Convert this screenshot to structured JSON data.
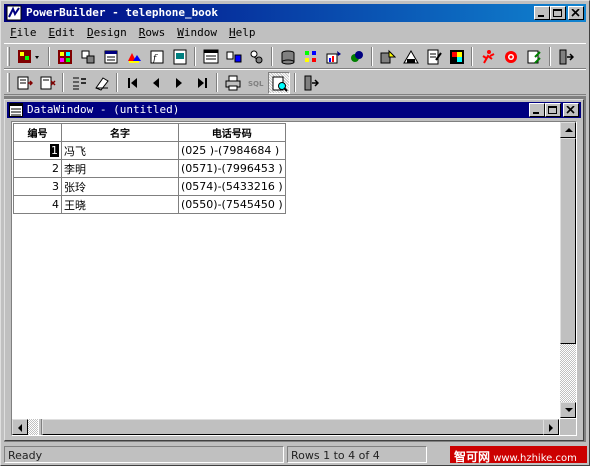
{
  "window": {
    "title": "PowerBuilder - telephone_book",
    "controls": [
      "minimize",
      "maximize",
      "close"
    ]
  },
  "menubar": [
    {
      "label": "File",
      "hotkey": "F",
      "rest": "ile"
    },
    {
      "label": "Edit",
      "hotkey": "E",
      "rest": "dit"
    },
    {
      "label": "Design",
      "hotkey": "D",
      "rest": "esign"
    },
    {
      "label": "Rows",
      "hotkey": "R",
      "rest": "ows"
    },
    {
      "label": "Window",
      "hotkey": "W",
      "rest": "indow"
    },
    {
      "label": "Help",
      "hotkey": "H",
      "rest": "elp"
    }
  ],
  "toolbar1": [
    "application-icon",
    "window-painter-icon",
    "user-object-icon",
    "menu-painter-icon",
    "structure-icon",
    "function-icon",
    "project-icon",
    "datawindow-icon",
    "query-icon",
    "pipeline-icon",
    "database-icon",
    "db-profile-icon",
    "library-icon",
    "browser-icon",
    "library-painter-icon",
    "edit-icon",
    "report-icon",
    "run-icon",
    "debug-icon",
    "help-icon",
    "exit-icon"
  ],
  "toolbar2": [
    "insert-row-icon",
    "delete-row-icon",
    "save-changes-icon",
    "sort-icon",
    "filter-icon",
    "first-page-icon",
    "prior-page-icon",
    "next-page-icon",
    "last-page-icon",
    "print-icon",
    "sql-icon",
    "zoom-preview-icon",
    "close-preview-icon"
  ],
  "child_window": {
    "title": "DataWindow - (untitled)"
  },
  "datawindow": {
    "columns": [
      "编号",
      "名字",
      "电话号码"
    ],
    "rows": [
      {
        "id": "1",
        "name": "冯飞",
        "phone": "(025 )-(7984684 )"
      },
      {
        "id": "2",
        "name": "李明",
        "phone": "(0571)-(7996453 )"
      },
      {
        "id": "3",
        "name": "张玲",
        "phone": "(0574)-(5433216 )"
      },
      {
        "id": "4",
        "name": "王晓",
        "phone": "(0550)-(7545450 )"
      }
    ]
  },
  "status": {
    "message": "Ready",
    "rows": "Rows 1 to 4 of 4"
  },
  "watermark": {
    "brand": "智可网",
    "url": "www.hzhike.com"
  },
  "colors": {
    "title_active": "#000080",
    "face": "#c0c0c0",
    "mdi_background": "#808080",
    "watermark": "#cc0000"
  }
}
